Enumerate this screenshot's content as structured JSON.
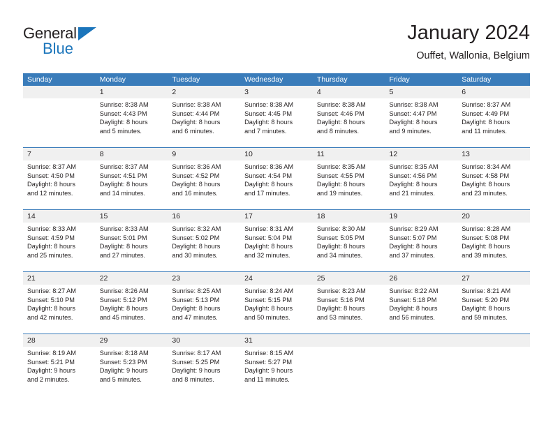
{
  "logo": {
    "text_top": "General",
    "text_bottom": "Blue",
    "triangle_color": "#1b75bb",
    "top_color": "#231f20"
  },
  "header": {
    "title": "January 2024",
    "subtitle": "Ouffet, Wallonia, Belgium"
  },
  "colors": {
    "header_blue": "#3a7cba",
    "date_band": "#f0f0f0",
    "text": "#231f20"
  },
  "calendar": {
    "weekday_headers": [
      "Sunday",
      "Monday",
      "Tuesday",
      "Wednesday",
      "Thursday",
      "Friday",
      "Saturday"
    ],
    "weeks": [
      [
        {
          "day": "",
          "lines": []
        },
        {
          "day": "1",
          "lines": [
            "Sunrise: 8:38 AM",
            "Sunset: 4:43 PM",
            "Daylight: 8 hours",
            "and 5 minutes."
          ]
        },
        {
          "day": "2",
          "lines": [
            "Sunrise: 8:38 AM",
            "Sunset: 4:44 PM",
            "Daylight: 8 hours",
            "and 6 minutes."
          ]
        },
        {
          "day": "3",
          "lines": [
            "Sunrise: 8:38 AM",
            "Sunset: 4:45 PM",
            "Daylight: 8 hours",
            "and 7 minutes."
          ]
        },
        {
          "day": "4",
          "lines": [
            "Sunrise: 8:38 AM",
            "Sunset: 4:46 PM",
            "Daylight: 8 hours",
            "and 8 minutes."
          ]
        },
        {
          "day": "5",
          "lines": [
            "Sunrise: 8:38 AM",
            "Sunset: 4:47 PM",
            "Daylight: 8 hours",
            "and 9 minutes."
          ]
        },
        {
          "day": "6",
          "lines": [
            "Sunrise: 8:37 AM",
            "Sunset: 4:49 PM",
            "Daylight: 8 hours",
            "and 11 minutes."
          ]
        }
      ],
      [
        {
          "day": "7",
          "lines": [
            "Sunrise: 8:37 AM",
            "Sunset: 4:50 PM",
            "Daylight: 8 hours",
            "and 12 minutes."
          ]
        },
        {
          "day": "8",
          "lines": [
            "Sunrise: 8:37 AM",
            "Sunset: 4:51 PM",
            "Daylight: 8 hours",
            "and 14 minutes."
          ]
        },
        {
          "day": "9",
          "lines": [
            "Sunrise: 8:36 AM",
            "Sunset: 4:52 PM",
            "Daylight: 8 hours",
            "and 16 minutes."
          ]
        },
        {
          "day": "10",
          "lines": [
            "Sunrise: 8:36 AM",
            "Sunset: 4:54 PM",
            "Daylight: 8 hours",
            "and 17 minutes."
          ]
        },
        {
          "day": "11",
          "lines": [
            "Sunrise: 8:35 AM",
            "Sunset: 4:55 PM",
            "Daylight: 8 hours",
            "and 19 minutes."
          ]
        },
        {
          "day": "12",
          "lines": [
            "Sunrise: 8:35 AM",
            "Sunset: 4:56 PM",
            "Daylight: 8 hours",
            "and 21 minutes."
          ]
        },
        {
          "day": "13",
          "lines": [
            "Sunrise: 8:34 AM",
            "Sunset: 4:58 PM",
            "Daylight: 8 hours",
            "and 23 minutes."
          ]
        }
      ],
      [
        {
          "day": "14",
          "lines": [
            "Sunrise: 8:33 AM",
            "Sunset: 4:59 PM",
            "Daylight: 8 hours",
            "and 25 minutes."
          ]
        },
        {
          "day": "15",
          "lines": [
            "Sunrise: 8:33 AM",
            "Sunset: 5:01 PM",
            "Daylight: 8 hours",
            "and 27 minutes."
          ]
        },
        {
          "day": "16",
          "lines": [
            "Sunrise: 8:32 AM",
            "Sunset: 5:02 PM",
            "Daylight: 8 hours",
            "and 30 minutes."
          ]
        },
        {
          "day": "17",
          "lines": [
            "Sunrise: 8:31 AM",
            "Sunset: 5:04 PM",
            "Daylight: 8 hours",
            "and 32 minutes."
          ]
        },
        {
          "day": "18",
          "lines": [
            "Sunrise: 8:30 AM",
            "Sunset: 5:05 PM",
            "Daylight: 8 hours",
            "and 34 minutes."
          ]
        },
        {
          "day": "19",
          "lines": [
            "Sunrise: 8:29 AM",
            "Sunset: 5:07 PM",
            "Daylight: 8 hours",
            "and 37 minutes."
          ]
        },
        {
          "day": "20",
          "lines": [
            "Sunrise: 8:28 AM",
            "Sunset: 5:08 PM",
            "Daylight: 8 hours",
            "and 39 minutes."
          ]
        }
      ],
      [
        {
          "day": "21",
          "lines": [
            "Sunrise: 8:27 AM",
            "Sunset: 5:10 PM",
            "Daylight: 8 hours",
            "and 42 minutes."
          ]
        },
        {
          "day": "22",
          "lines": [
            "Sunrise: 8:26 AM",
            "Sunset: 5:12 PM",
            "Daylight: 8 hours",
            "and 45 minutes."
          ]
        },
        {
          "day": "23",
          "lines": [
            "Sunrise: 8:25 AM",
            "Sunset: 5:13 PM",
            "Daylight: 8 hours",
            "and 47 minutes."
          ]
        },
        {
          "day": "24",
          "lines": [
            "Sunrise: 8:24 AM",
            "Sunset: 5:15 PM",
            "Daylight: 8 hours",
            "and 50 minutes."
          ]
        },
        {
          "day": "25",
          "lines": [
            "Sunrise: 8:23 AM",
            "Sunset: 5:16 PM",
            "Daylight: 8 hours",
            "and 53 minutes."
          ]
        },
        {
          "day": "26",
          "lines": [
            "Sunrise: 8:22 AM",
            "Sunset: 5:18 PM",
            "Daylight: 8 hours",
            "and 56 minutes."
          ]
        },
        {
          "day": "27",
          "lines": [
            "Sunrise: 8:21 AM",
            "Sunset: 5:20 PM",
            "Daylight: 8 hours",
            "and 59 minutes."
          ]
        }
      ],
      [
        {
          "day": "28",
          "lines": [
            "Sunrise: 8:19 AM",
            "Sunset: 5:21 PM",
            "Daylight: 9 hours",
            "and 2 minutes."
          ]
        },
        {
          "day": "29",
          "lines": [
            "Sunrise: 8:18 AM",
            "Sunset: 5:23 PM",
            "Daylight: 9 hours",
            "and 5 minutes."
          ]
        },
        {
          "day": "30",
          "lines": [
            "Sunrise: 8:17 AM",
            "Sunset: 5:25 PM",
            "Daylight: 9 hours",
            "and 8 minutes."
          ]
        },
        {
          "day": "31",
          "lines": [
            "Sunrise: 8:15 AM",
            "Sunset: 5:27 PM",
            "Daylight: 9 hours",
            "and 11 minutes."
          ]
        },
        {
          "day": "",
          "lines": []
        },
        {
          "day": "",
          "lines": []
        },
        {
          "day": "",
          "lines": []
        }
      ]
    ]
  }
}
